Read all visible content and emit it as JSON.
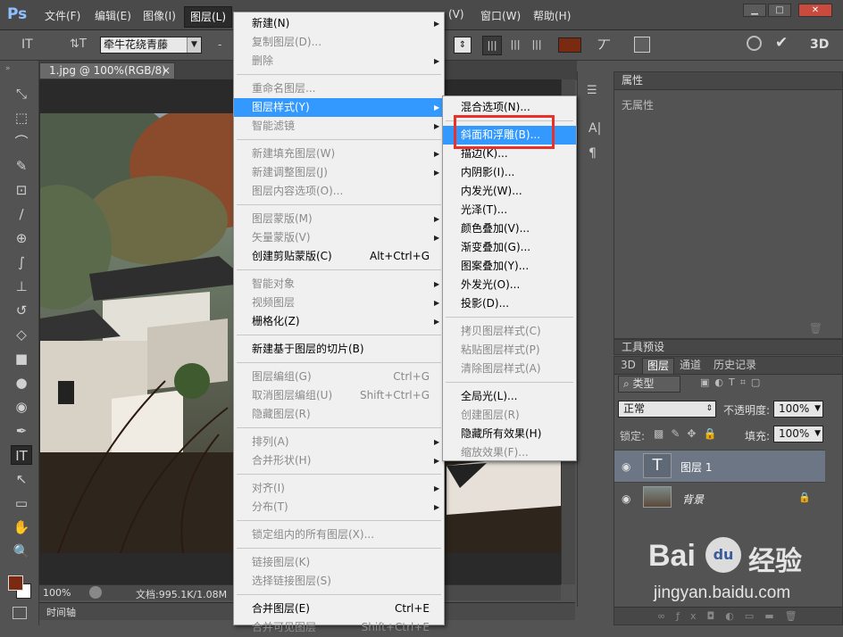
{
  "app": {
    "logo": "Ps"
  },
  "menubar": {
    "items": [
      "文件(F)",
      "编辑(E)",
      "图像(I)",
      "图层(L)",
      "(V)",
      "窗口(W)",
      "帮助(H)"
    ],
    "window": [
      "▁",
      "□",
      "✕"
    ]
  },
  "options": {
    "tool_glyph": "IT",
    "orient_glyph": "⇅T",
    "font_family": "牵牛花绕青藤",
    "size_dash": "-",
    "brand_color": "#7a2a10",
    "threed": "3D"
  },
  "tools": [
    "⤡",
    "⬚",
    "⌒",
    "✎",
    "⊡",
    "∕",
    "⊕",
    "∫",
    "⊥",
    "↺",
    "◇",
    "■",
    "●",
    "◉",
    "✒",
    "IT",
    "↖",
    "▭",
    "✋",
    "🔍"
  ],
  "document": {
    "tab": "1.jpg @ 100%(RGB/8)",
    "tab_close": "×",
    "zoom": "100%",
    "doc_info": "文档:995.1K/1.08M",
    "timeline": "时间轴"
  },
  "properties": {
    "title": "属性",
    "empty": "无属性"
  },
  "dock": {
    "letters": "A|",
    "para": "¶"
  },
  "presets": {
    "title": "工具预设"
  },
  "layers": {
    "tabs": [
      "3D",
      "图层",
      "通道",
      "历史记录"
    ],
    "filter": "类型",
    "blend_mode": "正常",
    "opacity_label": "不透明度:",
    "opacity": "100%",
    "lock_label": "锁定:",
    "fill_label": "填充:",
    "fill": "100%",
    "rows": [
      {
        "name": "图层 1",
        "type": "text",
        "selected": true
      },
      {
        "name": "背景",
        "type": "image",
        "selected": false
      }
    ]
  },
  "layer_menu": {
    "items": [
      {
        "label": "新建(N)",
        "arrow": true
      },
      {
        "label": "复制图层(D)...",
        "dis": true
      },
      {
        "label": "删除",
        "dis": true,
        "arrow": true
      },
      {
        "sep": true
      },
      {
        "label": "重命名图层...",
        "dis": true
      },
      {
        "label": "图层样式(Y)",
        "arrow": true,
        "hl": true
      },
      {
        "label": "智能滤镜",
        "dis": true,
        "arrow": true
      },
      {
        "sep": true
      },
      {
        "label": "新建填充图层(W)",
        "dis": true,
        "arrow": true
      },
      {
        "label": "新建调整图层(J)",
        "dis": true,
        "arrow": true
      },
      {
        "label": "图层内容选项(O)...",
        "dis": true
      },
      {
        "sep": true
      },
      {
        "label": "图层蒙版(M)",
        "dis": true,
        "arrow": true
      },
      {
        "label": "矢量蒙版(V)",
        "dis": true,
        "arrow": true
      },
      {
        "label": "创建剪贴蒙版(C)",
        "shortcut": "Alt+Ctrl+G"
      },
      {
        "sep": true
      },
      {
        "label": "智能对象",
        "dis": true,
        "arrow": true
      },
      {
        "label": "视频图层",
        "dis": true,
        "arrow": true
      },
      {
        "label": "栅格化(Z)",
        "arrow": true
      },
      {
        "sep": true
      },
      {
        "label": "新建基于图层的切片(B)"
      },
      {
        "sep": true
      },
      {
        "label": "图层编组(G)",
        "dis": true,
        "shortcut": "Ctrl+G"
      },
      {
        "label": "取消图层编组(U)",
        "dis": true,
        "shortcut": "Shift+Ctrl+G"
      },
      {
        "label": "隐藏图层(R)",
        "dis": true
      },
      {
        "sep": true
      },
      {
        "label": "排列(A)",
        "dis": true,
        "arrow": true
      },
      {
        "label": "合并形状(H)",
        "dis": true,
        "arrow": true
      },
      {
        "sep": true
      },
      {
        "label": "对齐(I)",
        "dis": true,
        "arrow": true
      },
      {
        "label": "分布(T)",
        "dis": true,
        "arrow": true
      },
      {
        "sep": true
      },
      {
        "label": "锁定组内的所有图层(X)...",
        "dis": true
      },
      {
        "sep": true
      },
      {
        "label": "链接图层(K)",
        "dis": true
      },
      {
        "label": "选择链接图层(S)",
        "dis": true
      },
      {
        "sep": true
      },
      {
        "label": "合并图层(E)",
        "shortcut": "Ctrl+E"
      },
      {
        "label": "合并可见图层",
        "dis": true,
        "shortcut": "Shift+Ctrl+E"
      }
    ]
  },
  "style_menu": {
    "items": [
      {
        "label": "混合选项(N)..."
      },
      {
        "sep": true
      },
      {
        "label": "斜面和浮雕(B)...",
        "hl": true
      },
      {
        "label": "描边(K)..."
      },
      {
        "label": "内阴影(I)..."
      },
      {
        "label": "内发光(W)..."
      },
      {
        "label": "光泽(T)..."
      },
      {
        "label": "颜色叠加(V)..."
      },
      {
        "label": "渐变叠加(G)..."
      },
      {
        "label": "图案叠加(Y)..."
      },
      {
        "label": "外发光(O)..."
      },
      {
        "label": "投影(D)..."
      },
      {
        "sep": true
      },
      {
        "label": "拷贝图层样式(C)",
        "dis": true
      },
      {
        "label": "粘贴图层样式(P)",
        "dis": true
      },
      {
        "label": "清除图层样式(A)",
        "dis": true
      },
      {
        "sep": true
      },
      {
        "label": "全局光(L)..."
      },
      {
        "label": "创建图层(R)",
        "dis": true
      },
      {
        "label": "隐藏所有效果(H)"
      },
      {
        "label": "缩放效果(F)...",
        "dis": true
      }
    ]
  },
  "watermark": {
    "brand": "Bai",
    "paw": "du",
    "cn": "经验",
    "url": "jingyan.baidu.com"
  }
}
